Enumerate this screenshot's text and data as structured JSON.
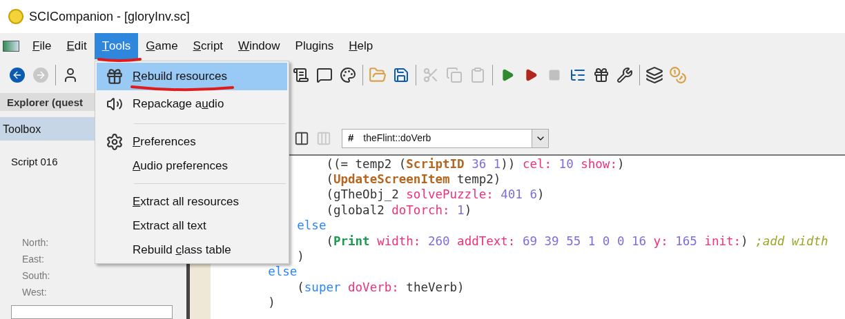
{
  "window": {
    "title": "SCICompanion - [gloryInv.sc]"
  },
  "menu_bar": [
    {
      "parts": [
        {
          "text": "F",
          "underlined": true
        },
        {
          "text": "ile",
          "underlined": false
        }
      ],
      "selected": false
    },
    {
      "parts": [
        {
          "text": "E",
          "underlined": true
        },
        {
          "text": "dit",
          "underlined": false
        }
      ],
      "selected": false
    },
    {
      "parts": [
        {
          "text": "T",
          "underlined": true
        },
        {
          "text": "ools",
          "underlined": false
        }
      ],
      "selected": true
    },
    {
      "parts": [
        {
          "text": "G",
          "underlined": true
        },
        {
          "text": "ame",
          "underlined": false
        }
      ],
      "selected": false
    },
    {
      "parts": [
        {
          "text": "S",
          "underlined": true
        },
        {
          "text": "cript",
          "underlined": false
        }
      ],
      "selected": false
    },
    {
      "parts": [
        {
          "text": "W",
          "underlined": true
        },
        {
          "text": "indow",
          "underlined": false
        }
      ],
      "selected": false
    },
    {
      "parts": [
        {
          "text": "Plugins",
          "underlined": false
        }
      ],
      "selected": false
    },
    {
      "parts": [
        {
          "text": "H",
          "underlined": true
        },
        {
          "text": "elp",
          "underlined": false
        }
      ],
      "selected": false
    }
  ],
  "tools_menu": [
    {
      "kind": "item",
      "parts": [
        {
          "text": "R",
          "underlined": true
        },
        {
          "text": "ebuild resources",
          "underlined": false
        }
      ],
      "selected": true
    },
    {
      "kind": "item",
      "parts": [
        {
          "text": "Repackage a",
          "underlined": false
        },
        {
          "text": "u",
          "underlined": true
        },
        {
          "text": "dio",
          "underlined": false
        }
      ],
      "selected": false
    },
    {
      "kind": "separator"
    },
    {
      "kind": "item",
      "parts": [
        {
          "text": "P",
          "underlined": true
        },
        {
          "text": "references",
          "underlined": false
        }
      ],
      "selected": false
    },
    {
      "kind": "item",
      "parts": [
        {
          "text": "A",
          "underlined": true
        },
        {
          "text": "udio preferences",
          "underlined": false
        }
      ],
      "selected": false
    },
    {
      "kind": "separator"
    },
    {
      "kind": "item",
      "parts": [
        {
          "text": "E",
          "underlined": true
        },
        {
          "text": "xtract all resources",
          "underlined": false
        }
      ],
      "selected": false
    },
    {
      "kind": "item",
      "parts": [
        {
          "text": "Extract all text",
          "underlined": false
        }
      ],
      "selected": false
    },
    {
      "kind": "item",
      "parts": [
        {
          "text": "Rebuild ",
          "underlined": false
        },
        {
          "text": "c",
          "underlined": true
        },
        {
          "text": "lass table",
          "underlined": false
        }
      ],
      "selected": false
    }
  ],
  "left_panel": {
    "explorer_tab": "Explorer (quest",
    "toolbox": "Toolbox",
    "script": "Script 016",
    "directions": [
      "North:",
      "East:",
      "South:",
      "West:"
    ]
  },
  "method_dropdown": {
    "icon_text": "#",
    "value": "theFlint::doVerb"
  },
  "code_lines": [
    [
      {
        "kind": "paren",
        "text": "            ((= temp2 ("
      },
      {
        "kind": "proc",
        "text": "ScriptID"
      },
      {
        "kind": "number",
        "text": " 36 1"
      },
      {
        "kind": "paren",
        "text": ")) "
      },
      {
        "kind": "selector",
        "text": "cel:"
      },
      {
        "kind": "number",
        "text": " 10 "
      },
      {
        "kind": "selector",
        "text": "show:"
      },
      {
        "kind": "paren",
        "text": ")"
      }
    ],
    [
      {
        "kind": "paren",
        "text": "            ("
      },
      {
        "kind": "proc",
        "text": "UpdateScreenItem"
      },
      {
        "kind": "paren",
        "text": " temp2)"
      }
    ],
    [
      {
        "kind": "paren",
        "text": "            (gTheObj_2 "
      },
      {
        "kind": "selector",
        "text": "solvePuzzle:"
      },
      {
        "kind": "number",
        "text": " 401 6"
      },
      {
        "kind": "paren",
        "text": ")"
      }
    ],
    [
      {
        "kind": "paren",
        "text": "            (global2 "
      },
      {
        "kind": "selector",
        "text": "doTorch:"
      },
      {
        "kind": "number",
        "text": " 1"
      },
      {
        "kind": "paren",
        "text": ")"
      }
    ],
    [
      {
        "kind": "keyword",
        "text": "        else"
      }
    ],
    [
      {
        "kind": "paren",
        "text": "            ("
      },
      {
        "kind": "print",
        "text": "Print"
      },
      {
        "kind": "selector",
        "text": " width:"
      },
      {
        "kind": "number",
        "text": " 260 "
      },
      {
        "kind": "selector",
        "text": "addText:"
      },
      {
        "kind": "number",
        "text": " 69 39 55 1 0 0 16 "
      },
      {
        "kind": "selector",
        "text": "y:"
      },
      {
        "kind": "number",
        "text": " 165 "
      },
      {
        "kind": "selector",
        "text": "init:"
      },
      {
        "kind": "paren",
        "text": ") "
      },
      {
        "kind": "comment",
        "text": ";add width"
      }
    ],
    [
      {
        "kind": "paren",
        "text": "        )"
      }
    ],
    [
      {
        "kind": "keyword",
        "text": "    else"
      }
    ],
    [
      {
        "kind": "paren",
        "text": "        ("
      },
      {
        "kind": "keyword",
        "text": "super"
      },
      {
        "kind": "selector",
        "text": " doVerb:"
      },
      {
        "kind": "paren",
        "text": " theVerb)"
      }
    ],
    [
      {
        "kind": "paren",
        "text": "    )"
      }
    ]
  ]
}
